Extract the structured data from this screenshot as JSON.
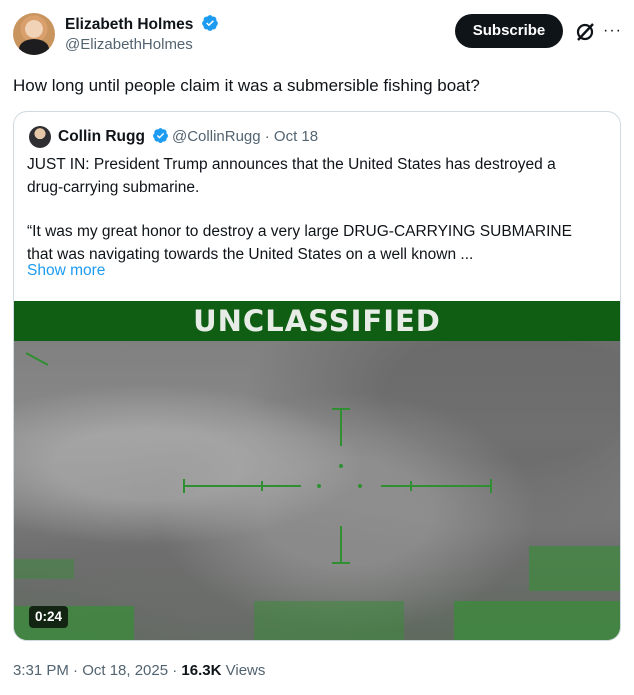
{
  "tweet": {
    "author_name": "Elizabeth Holmes",
    "author_handle": "@ElizabethHolmes",
    "subscribe_label": "Subscribe",
    "more_label": "···",
    "text": "How long until people claim it was a submersible fishing boat?",
    "time": "3:31 PM · Oct 18, 2025 ·",
    "views_count": "16.3K",
    "views_label": "Views"
  },
  "quote": {
    "author_name": "Collin Rugg",
    "handle_date": "@CollinRugg · Oct 18",
    "line1": "JUST IN: President Trump announces that the United States has destroyed a",
    "line2": "drug-carrying submarine.",
    "line3": "“It was my great honor to destroy a very large DRUG-CARRYING SUBMARINE",
    "line4": "that was navigating towards the United States on a well known ...",
    "show_more": "Show more",
    "video_label": "UNCLASSIFIED",
    "video_duration": "0:24"
  },
  "colors": {
    "verified_blue": "#1d9bf0",
    "link_blue": "#1d9bf0",
    "muted_text": "#536471",
    "video_band_green": "#0f5e14"
  },
  "icons": [
    "verified-badge-icon",
    "grok-icon",
    "more-icon"
  ]
}
